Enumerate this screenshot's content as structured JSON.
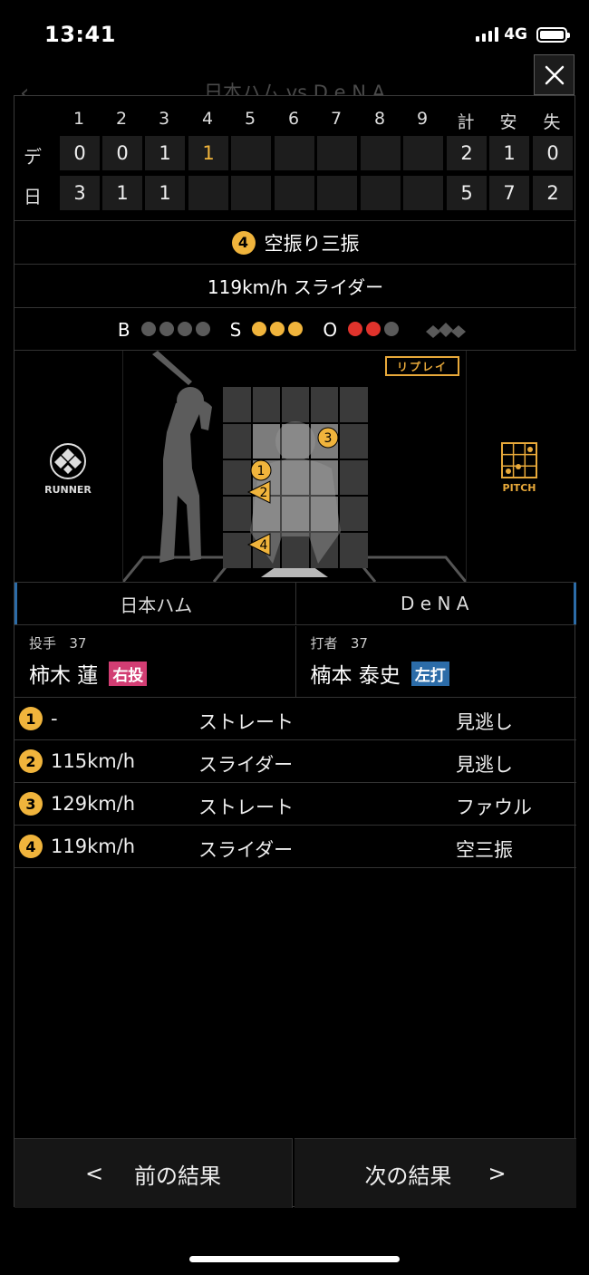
{
  "status": {
    "time": "13:41",
    "network": "4G"
  },
  "background": {
    "title": "日本ハム vs D e N A",
    "back_icon": "chevron-left-icon"
  },
  "scoreboard": {
    "headers": [
      "1",
      "2",
      "3",
      "4",
      "5",
      "6",
      "7",
      "8",
      "9",
      "計",
      "安",
      "失"
    ],
    "teams": [
      {
        "abbr": "デ",
        "cells": [
          "0",
          "0",
          "1",
          "1",
          "",
          "",
          "",
          "",
          "",
          "2",
          "1",
          "0"
        ],
        "highlight_index": 3
      },
      {
        "abbr": "日",
        "cells": [
          "3",
          "1",
          "1",
          "",
          "",
          "",
          "",
          "",
          "",
          "5",
          "7",
          "2"
        ]
      }
    ]
  },
  "result": {
    "pitch_no": "4",
    "text": "空振り三振",
    "speed_type": "119km/h スライダー"
  },
  "count": {
    "b_label": "B",
    "s_label": "S",
    "o_label": "O",
    "balls": 0,
    "strikes": 3,
    "outs": 2,
    "colors": {
      "ball_off": "#5a5a5a",
      "strike_on": "#f0b43c",
      "out_on": "#e0332c"
    }
  },
  "field": {
    "runner_label": "RUNNER",
    "pitch_label": "PITCH",
    "replay_label": "リプレイ",
    "pitches": [
      {
        "no": "1",
        "shape": "circle"
      },
      {
        "no": "2",
        "shape": "triangle"
      },
      {
        "no": "3",
        "shape": "circle"
      },
      {
        "no": "4",
        "shape": "triangle"
      }
    ]
  },
  "teams": {
    "left": "日本ハム",
    "right": "D e N A"
  },
  "pitcher": {
    "role": "投手",
    "number": "37",
    "name": "柿木 蓮",
    "hand": "右投"
  },
  "batter": {
    "role": "打者",
    "number": "37",
    "name": "楠本 泰史",
    "hand": "左打"
  },
  "pitch_list": [
    {
      "no": "1",
      "speed": "-",
      "type": "ストレート",
      "result": "見逃し"
    },
    {
      "no": "2",
      "speed": "115km/h",
      "type": "スライダー",
      "result": "見逃し"
    },
    {
      "no": "3",
      "speed": "129km/h",
      "type": "ストレート",
      "result": "ファウル"
    },
    {
      "no": "4",
      "speed": "119km/h",
      "type": "スライダー",
      "result": "空三振"
    }
  ],
  "nav": {
    "prev_arrow": "<",
    "prev_label": "前の結果",
    "next_label": "次の結果",
    "next_arrow": ">"
  },
  "colors": {
    "accent": "#f0b43c",
    "team_blue": "#2c6ca8",
    "pitcher_tag": "#d23d73"
  }
}
